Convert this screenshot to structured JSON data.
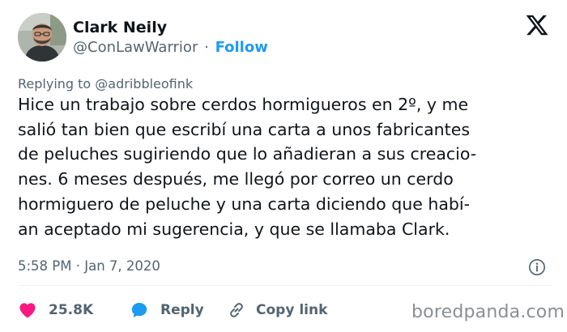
{
  "author": {
    "name": "Clark Neily",
    "handle": "@ConLawWarrior",
    "separator": "·",
    "follow_label": "Follow"
  },
  "replying": {
    "prefix": "Replying to ",
    "mention": "@adribbleofink"
  },
  "tweet": {
    "lines": [
      "Hice un trabajo sobre cerdos hormigueros en 2º, y me",
      "salió tan bien que escribí una carta a unos fabricantes",
      "de peluches sugiriendo que lo añadieran a sus creacio-",
      "nes. 6 meses después, me llegó por correo un cerdo",
      "hormiguero de peluche y una carta diciendo que habí-",
      "an aceptado mi sugerencia, y que se llamaba Clark."
    ]
  },
  "meta": {
    "time": "5:58 PM",
    "separator": "·",
    "date": "Jan 7, 2020"
  },
  "actions": {
    "likes_count": "25.8K",
    "reply_label": "Reply",
    "copy_label": "Copy link"
  },
  "watermark": "boredpanda.com",
  "icons": {
    "platform": "x-logo-icon",
    "info": "info-icon",
    "like": "heart-icon",
    "reply": "speech-bubble-icon",
    "copy": "link-icon"
  },
  "colors": {
    "accent": "#1d9bf0",
    "like": "#f91880",
    "muted": "#536471",
    "text": "#0f1419"
  }
}
